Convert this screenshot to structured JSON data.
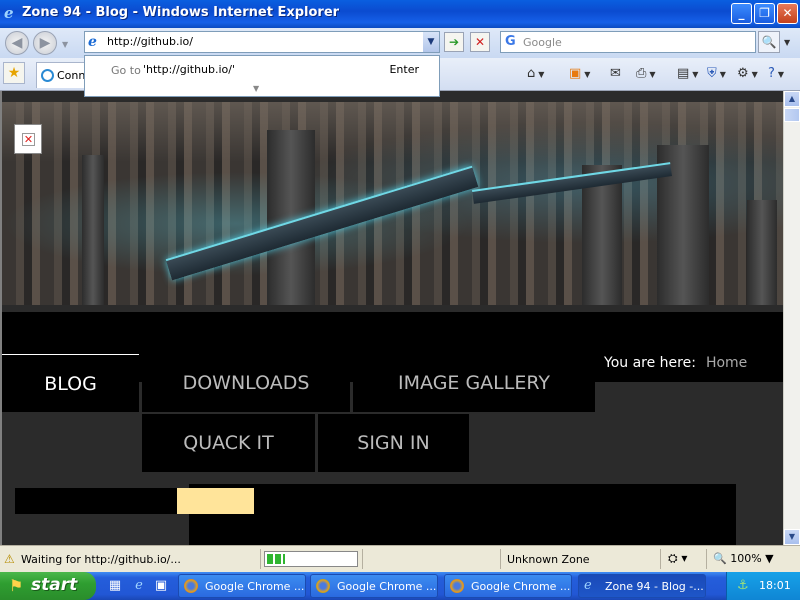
{
  "window": {
    "title": "Zone 94 - Blog - Windows Internet Explorer"
  },
  "address": {
    "url": "http://github.io/",
    "autocomplete_prefix": "Go to",
    "autocomplete_url": "'http://github.io/'",
    "autocomplete_action": "Enter"
  },
  "search": {
    "placeholder": "Google"
  },
  "tab": {
    "label": "Conn"
  },
  "page": {
    "menu": {
      "blog": "BLOG",
      "downloads": "DOWNLOADS",
      "image_gallery": "IMAGE GALLERY",
      "quack_it": "QUACK IT",
      "sign_in": "SIGN IN"
    },
    "breadcrumb": {
      "label": "You are here:",
      "home": "Home"
    }
  },
  "status": {
    "message": "Waiting for http://github.io/...",
    "zone": "Unknown Zone",
    "zoom": "100%",
    "progress": 0.2
  },
  "taskbar": {
    "start": "start",
    "tasks": [
      {
        "label": "Google Chrome ..."
      },
      {
        "label": "Google Chrome ..."
      },
      {
        "label": "Google Chrome ..."
      },
      {
        "label": "Zone 94 - Blog -..."
      }
    ],
    "clock": "18:01"
  },
  "colors": {
    "title_bar": "#0b4bd0",
    "start_green": "#2f9e31",
    "highlight": "#ffe49a",
    "progress_green": "#2fb530"
  }
}
